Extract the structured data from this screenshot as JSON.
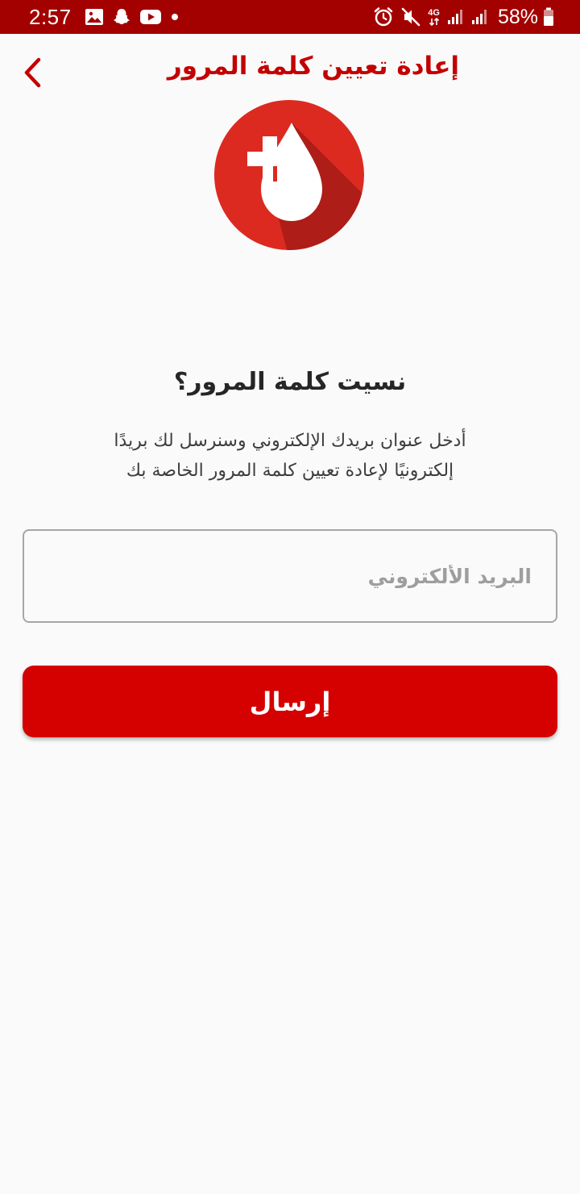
{
  "status_bar": {
    "time": "2:57",
    "battery_percent": "58%",
    "network_label": "4G",
    "left_icons": [
      "gallery-icon",
      "snapchat-icon",
      "youtube-icon",
      "notification-dot-icon"
    ],
    "right_icons": [
      "alarm-icon",
      "mute-icon",
      "signal-icon",
      "battery-icon"
    ],
    "background_color": "#a30000"
  },
  "app_bar": {
    "title": "إعادة تعيين كلمة المرور",
    "back_icon": "chevron-left-icon",
    "accent_color": "#c40000"
  },
  "logo": {
    "icon": "blood-drop-plus-icon",
    "circle_color": "#dc2a20",
    "shadow_color": "#ae1d17"
  },
  "main": {
    "heading": "نسيت كلمة المرور؟",
    "description_line1": "أدخل عنوان بريدك الإلكتروني وسنرسل لك بريدًا",
    "description_line2": "إلكترونيًا لإعادة تعيين كلمة المرور الخاصة بك",
    "email_field": {
      "value": "",
      "placeholder": "البريد الألكتروني"
    },
    "send_button_label": "إرسال",
    "button_color": "#d50000"
  }
}
